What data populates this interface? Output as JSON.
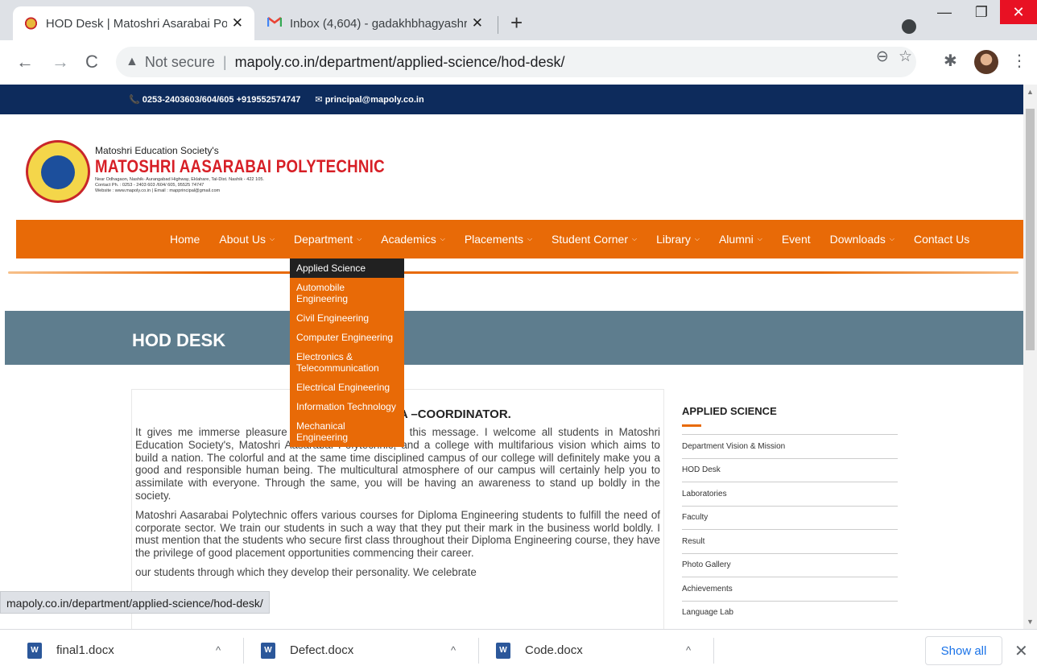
{
  "browser": {
    "tabs": [
      {
        "title": "HOD Desk | Matoshri Asarabai Po",
        "close": "✕",
        "active": true
      },
      {
        "title": "Inbox (4,604) - gadakhbhagyashr",
        "close": "✕",
        "active": false
      }
    ],
    "new_tab": "+",
    "window_controls": {
      "minimize": "—",
      "maximize": "❐",
      "close": "✕"
    },
    "nav": {
      "back": "←",
      "forward": "→",
      "reload": "C"
    },
    "address": {
      "security": "Not secure",
      "separator": "|",
      "url": "mapoly.co.in/department/applied-science/hod-desk/"
    },
    "toolbar_icons": {
      "zoom": "⊖",
      "bookmark": "☆",
      "extensions": "✱",
      "menu": "⋮"
    }
  },
  "site": {
    "topbar": {
      "phone": "📞 0253-2403603/604/605 +919552574747",
      "email": "✉ principal@mapoly.co.in"
    },
    "logo": {
      "society": "Matoshri Education Society's",
      "name": "MATOSHRI AASARABAI POLYTECHNIC",
      "address_line1": "Near Odhagaon, Nashik- Aurangabad Highway, Eklahare, Tal-Dist. Nashik - 422 105.",
      "address_line2": "Contact Ph. : 0253 - 2403 603 /604/ 605, 95525 74747",
      "address_line3": "Website : www.mapoly.co.in | Email : mapprincipal@gmail.com"
    },
    "nav": [
      {
        "label": "Home",
        "dropdown": false
      },
      {
        "label": "About Us",
        "dropdown": true
      },
      {
        "label": "Department",
        "dropdown": true
      },
      {
        "label": "Academics",
        "dropdown": true
      },
      {
        "label": "Placements",
        "dropdown": true
      },
      {
        "label": "Student Corner",
        "dropdown": true
      },
      {
        "label": "Library",
        "dropdown": true
      },
      {
        "label": "Alumni",
        "dropdown": true
      },
      {
        "label": "Event",
        "dropdown": false
      },
      {
        "label": "Downloads",
        "dropdown": true
      },
      {
        "label": "Contact Us",
        "dropdown": false
      }
    ],
    "chevron": "⌵",
    "department_menu": [
      "Applied Science",
      "Automobile Engineering",
      "Civil Engineering",
      "Computer Engineering",
      "Electronics & Telecommunication",
      "Electrical Engineering",
      "Information Technology",
      "Mechanical Engineering"
    ],
    "page_title": "HOD DESK",
    "content": {
      "heading": "F                    A –COORDINATOR.",
      "p1": "It gives me immerse pleasure                      y all students through this message. I welcome all students in Matoshri Education Society's, Matoshri Aasarabai Polytechnic, and a college with multifarious vision which aims to build a nation. The colorful and at the same time disciplined campus of our college will definitely make you a good and responsible human being. The multicultural atmosphere of our campus will certainly help you to assimilate with everyone. Through the same, you will be having an awareness to stand up boldly in the society.",
      "p2": "Matoshri Aasarabai Polytechnic offers various courses for Diploma Engineering students to fulfill the need of corporate sector. We train our students in such a way that they put their mark in the business world boldly. I must mention that the students who secure first class throughout their Diploma Engineering course, they have the privilege of good placement opportunities commencing their career.",
      "p3": "                                                      our students through which they develop their personality. We celebrate"
    },
    "sidebar": {
      "heading": "APPLIED SCIENCE",
      "items": [
        "Department Vision & Mission",
        "HOD Desk",
        "Laboratories",
        "Faculty",
        "Result",
        "Photo Gallery",
        "Achievements",
        "Language Lab"
      ]
    },
    "status_url": "mapoly.co.in/department/applied-science/hod-desk/"
  },
  "downloads": {
    "items": [
      {
        "name": "final1.docx"
      },
      {
        "name": "Defect.docx"
      },
      {
        "name": "Code.docx"
      }
    ],
    "icon_letter": "W",
    "chevron": "^",
    "show_all": "Show all",
    "close": "✕"
  },
  "colors": {
    "nav_orange": "#e86a07",
    "topbar_navy": "#0d2b5c",
    "band_slate": "#5e7d8e",
    "logo_red": "#d71f26"
  }
}
